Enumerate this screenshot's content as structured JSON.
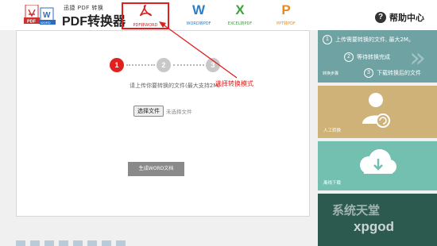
{
  "header": {
    "logo_sub": "迅捷 PDF 转换",
    "logo_main": "PDF转换器",
    "logo_badges": [
      "PDF",
      "WORD"
    ],
    "tabs": [
      {
        "icon": "acrobat-icon",
        "glyph": "",
        "label": "PDF转WORD"
      },
      {
        "icon": "word-icon",
        "glyph": "W",
        "label": "WORD转PDF"
      },
      {
        "icon": "excel-icon",
        "glyph": "X",
        "label": "EXCEL转PDF"
      },
      {
        "icon": "ppt-icon",
        "glyph": "P",
        "label": "PPT转PDF"
      }
    ],
    "help_glyph": "?",
    "help_label": "帮助中心"
  },
  "main": {
    "steps": [
      "1",
      "2",
      "3"
    ],
    "instruction": "请上传你要转换的文件(最大支持2M)",
    "choose_file_label": "选择文件",
    "file_status": "未选择文件",
    "generate_label": "生成WORD文档"
  },
  "annotation": "选择转换模式",
  "sidebar": {
    "steps_panel": {
      "lines": [
        {
          "num": "1",
          "text": "上传需要转换的文件, 最大2M。"
        },
        {
          "num": "2",
          "text": "等待转换完成"
        },
        {
          "num": "3",
          "text": "下载转换后的文件"
        }
      ],
      "caption": "转换步骤"
    },
    "manual_caption": "人工转换",
    "download_caption": "离线下载",
    "watermark": "系统天堂",
    "watermark_site": "xpgod"
  },
  "colors": {
    "accent_red": "#e12020",
    "panel_steps": "#6fa2a3",
    "panel_manual": "#cfb278",
    "panel_download": "#73bfb0",
    "panel_bottom": "#2c5a4f"
  }
}
